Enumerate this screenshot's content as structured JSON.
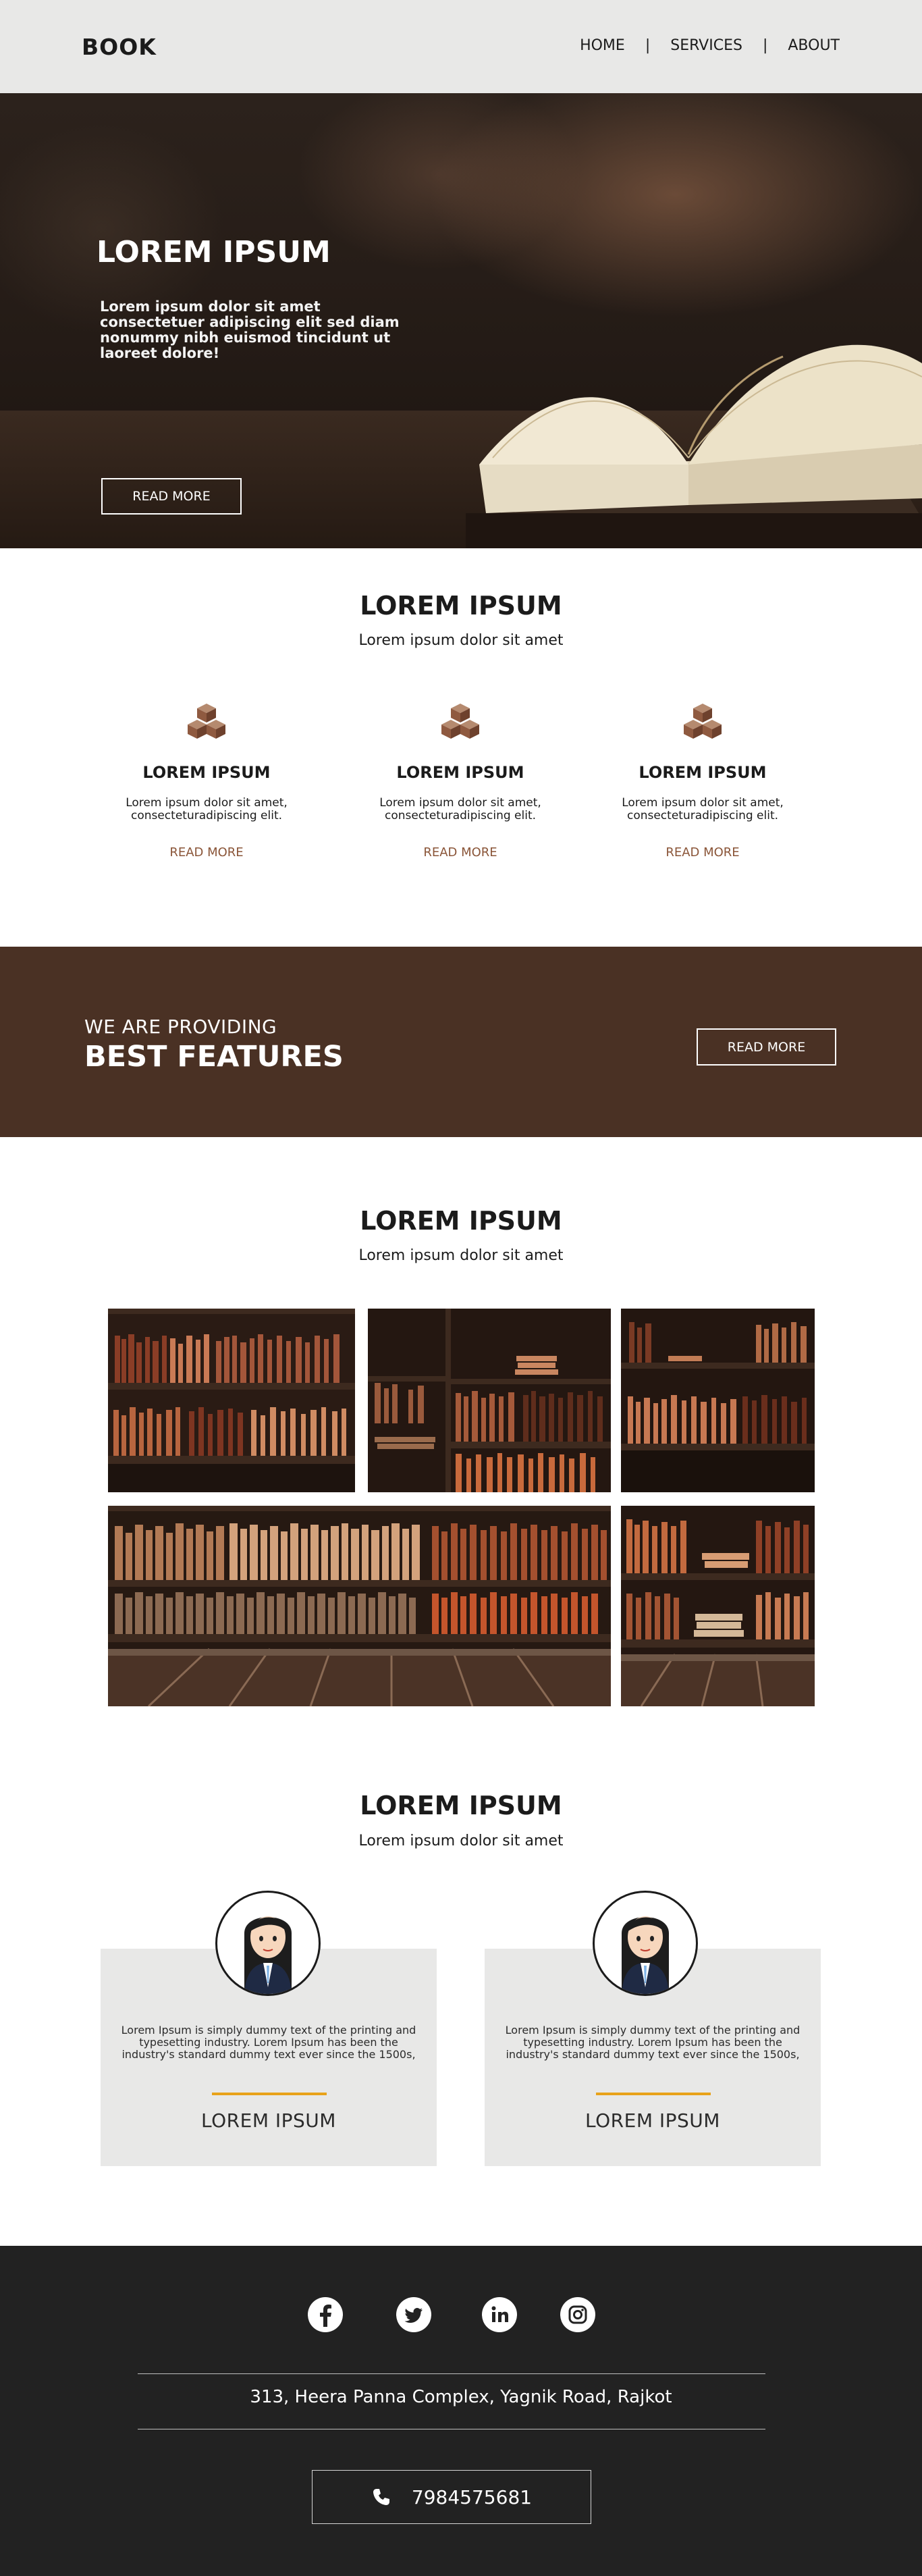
{
  "nav": {
    "brand": "BOOK",
    "items": [
      "HOME",
      "SERVICES",
      "ABOUT"
    ],
    "separator": "|"
  },
  "hero": {
    "title": "LOREM IPSUM",
    "text": "Lorem ipsum dolor sit amet consectetuer adipiscing elit sed diam nonummy nibh euismod tincidunt ut laoreet dolore!",
    "button": "READ MORE"
  },
  "services": {
    "title": "LOREM IPSUM",
    "subtitle": "Lorem ipsum dolor sit amet",
    "items": [
      {
        "icon": "boxes-icon",
        "title": "LOREM IPSUM",
        "text": "Lorem ipsum dolor sit amet, consecteturadipiscing elit.",
        "link": "READ MORE"
      },
      {
        "icon": "boxes-icon",
        "title": "LOREM IPSUM",
        "text": "Lorem ipsum dolor sit amet, consecteturadipiscing elit.",
        "link": "READ MORE"
      },
      {
        "icon": "boxes-icon",
        "title": "LOREM IPSUM",
        "text": "Lorem ipsum dolor sit amet, consecteturadipiscing elit.",
        "link": "READ MORE"
      }
    ]
  },
  "banner": {
    "small": "WE ARE PROVIDING",
    "big": "BEST FEATURES",
    "button": "READ MORE",
    "color": "#4a3124"
  },
  "gallery": {
    "title": "LOREM IPSUM",
    "subtitle": "Lorem ipsum dolor sit amet"
  },
  "testimonials": {
    "title": "LOREM IPSUM",
    "subtitle": "Lorem ipsum dolor sit amet",
    "items": [
      {
        "quote": "Lorem Ipsum is simply dummy text of the printing and typesetting industry. Lorem Ipsum has been the industry's standard dummy text ever since the 1500s,",
        "name": "LOREM IPSUM"
      },
      {
        "quote": "Lorem Ipsum is simply dummy text of the printing and typesetting industry. Lorem Ipsum has been the industry's standard dummy text ever since the 1500s,",
        "name": "LOREM IPSUM"
      }
    ],
    "accent": "#e8a21a"
  },
  "footer": {
    "social": [
      "facebook-icon",
      "twitter-icon",
      "linkedin-icon",
      "instagram-icon"
    ],
    "address": "313, Heera Panna Complex, Yagnik Road, Rajkot",
    "phone": "7984575681",
    "background": "#222222"
  }
}
